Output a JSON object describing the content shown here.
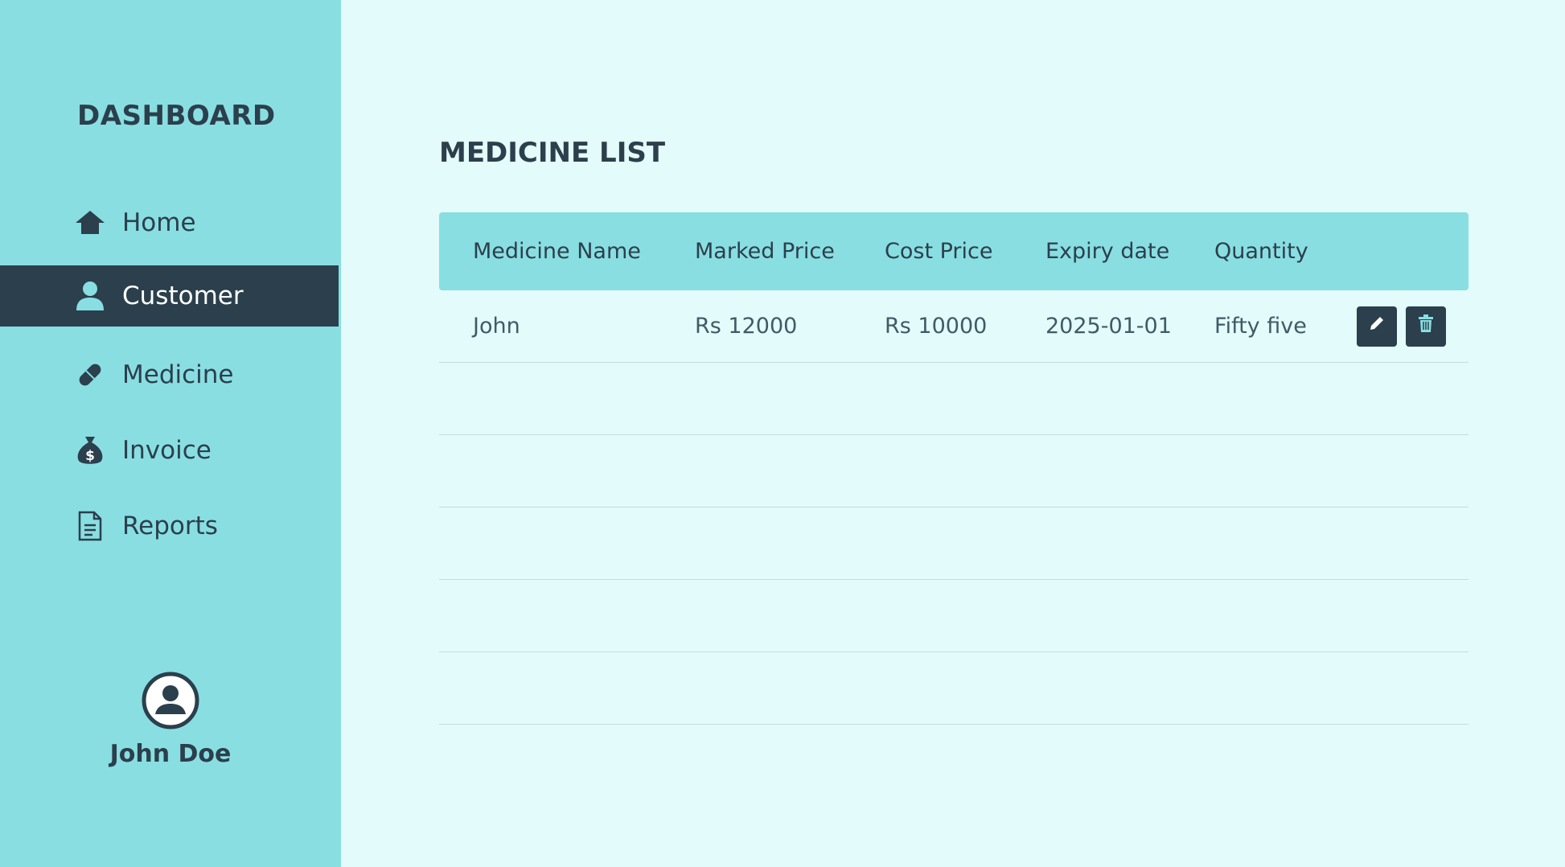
{
  "sidebar": {
    "brand": "DASHBOARD",
    "items": [
      {
        "label": "Home",
        "icon": "home-icon"
      },
      {
        "label": "Customer",
        "icon": "user-icon",
        "active": true
      },
      {
        "label": "Medicine",
        "icon": "pill-icon"
      },
      {
        "label": "Invoice",
        "icon": "money-bag-icon"
      },
      {
        "label": "Reports",
        "icon": "document-icon"
      }
    ],
    "user": {
      "name": "John Doe",
      "icon": "user-circle-icon"
    }
  },
  "main": {
    "title": "MEDICINE LIST",
    "table": {
      "columns": [
        "Medicine Name",
        "Marked Price",
        "Cost Price",
        "Expiry date",
        "Quantity"
      ],
      "rows": [
        {
          "name": "John",
          "marked_price": "Rs 12000",
          "cost_price": "Rs 10000",
          "expiry": "2025-01-01",
          "quantity": "Fifty five"
        }
      ],
      "actions": {
        "edit_icon": "pencil-icon",
        "delete_icon": "trash-icon"
      }
    }
  },
  "colors": {
    "sidebar_bg": "#89dee2",
    "page_bg": "#e3fbfa",
    "accent_dark": "#2b3f4c"
  }
}
